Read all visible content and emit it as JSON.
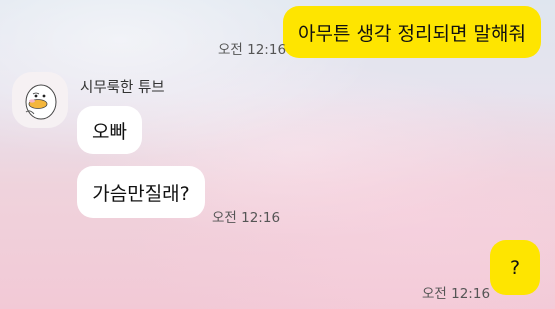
{
  "messages": [
    {
      "text": "아무튼 생각 정리되면 말해줘",
      "time": "오전 12:16"
    },
    {
      "sender": "시무룩한 튜브",
      "text": "오빠"
    },
    {
      "text": "가슴만질래?",
      "time": "오전 12:16"
    },
    {
      "text": "?",
      "time": "오전 12:16"
    }
  ],
  "colors": {
    "my_bubble": "#fee500",
    "their_bubble": "#ffffff"
  }
}
